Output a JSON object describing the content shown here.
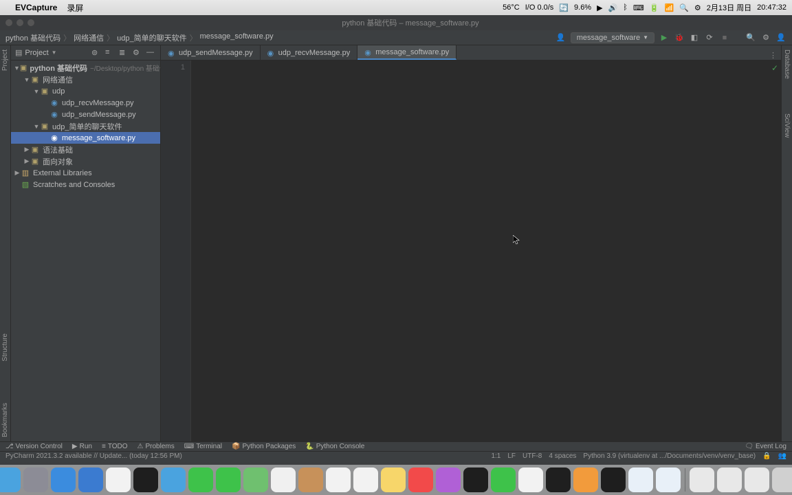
{
  "menubar": {
    "app": "EVCapture",
    "menu1": "录屏",
    "status": {
      "temp": "56°C",
      "io": "I/O 0.0/s",
      "cpu": "9.6%",
      "date": "2月13日 周日",
      "time": "20:47:32"
    }
  },
  "window_title": "python 基础代码 – message_software.py",
  "breadcrumbs": [
    "python 基础代码",
    "网络通信",
    "udp_简单的聊天软件",
    "message_software.py"
  ],
  "run_config": "message_software",
  "project_panel": {
    "title": "Project"
  },
  "tree": {
    "root": {
      "name": "python 基础代码",
      "hint": "~/Desktop/python 基础代码"
    },
    "net": "网络通信",
    "udp": "udp",
    "udp_recv": "udp_recvMessage.py",
    "udp_send": "udp_sendMessage.py",
    "udp_chat": "udp_简单的聊天软件",
    "msg_sw": "message_software.py",
    "grammar": "语法基础",
    "oop": "面向对象",
    "ext_lib": "External Libraries",
    "scratches": "Scratches and Consoles"
  },
  "tabs": [
    {
      "label": "udp_sendMessage.py",
      "active": false
    },
    {
      "label": "udp_recvMessage.py",
      "active": false
    },
    {
      "label": "message_software.py",
      "active": true
    }
  ],
  "gutter_line": "1",
  "bottom_tools": {
    "version_control": "Version Control",
    "run": "Run",
    "todo": "TODO",
    "problems": "Problems",
    "terminal": "Terminal",
    "py_pkg": "Python Packages",
    "py_console": "Python Console",
    "event_log": "Event Log"
  },
  "statusbar": {
    "left": "PyCharm 2021.3.2 available // Update... (today 12:56 PM)",
    "pos": "1:1",
    "le": "LF",
    "enc": "UTF-8",
    "indent": "4 spaces",
    "interpreter": "Python 3.9 (virtualenv at .../Documents/venv/venv_base)"
  },
  "left_tools": {
    "project": "Project",
    "structure": "Structure",
    "bookmarks": "Bookmarks"
  },
  "right_tools": {
    "database": "Database",
    "sciview": "SciView"
  },
  "dock_apps": [
    {
      "name": "finder",
      "bg": "#4aa3df"
    },
    {
      "name": "launchpad",
      "bg": "#8c8c96"
    },
    {
      "name": "safari",
      "bg": "#3b8cde"
    },
    {
      "name": "xcode",
      "bg": "#3b7bd0"
    },
    {
      "name": "chrome",
      "bg": "#f2f2f2"
    },
    {
      "name": "terminal",
      "bg": "#1e1e1e"
    },
    {
      "name": "mail",
      "bg": "#4aa3df"
    },
    {
      "name": "facetime",
      "bg": "#3ec24a"
    },
    {
      "name": "messages",
      "bg": "#3ec24a"
    },
    {
      "name": "maps",
      "bg": "#6fc06f"
    },
    {
      "name": "photos",
      "bg": "#f0f0f0"
    },
    {
      "name": "contacts",
      "bg": "#c7915a"
    },
    {
      "name": "calendar",
      "bg": "#f2f2f2"
    },
    {
      "name": "reminders",
      "bg": "#f2f2f2"
    },
    {
      "name": "notes",
      "bg": "#f7d66a"
    },
    {
      "name": "music",
      "bg": "#f24a4a"
    },
    {
      "name": "podcasts",
      "bg": "#b060d6"
    },
    {
      "name": "tv",
      "bg": "#1e1e1e"
    },
    {
      "name": "wechat",
      "bg": "#3ec24a"
    },
    {
      "name": "qq",
      "bg": "#f2f2f2"
    },
    {
      "name": "pycharm",
      "bg": "#1f1f1f"
    },
    {
      "name": "sublime",
      "bg": "#f29b3c"
    },
    {
      "name": "iina",
      "bg": "#1e1e1e"
    },
    {
      "name": "app1",
      "bg": "#e8f0f8"
    },
    {
      "name": "app2",
      "bg": "#e8f0f8"
    }
  ]
}
